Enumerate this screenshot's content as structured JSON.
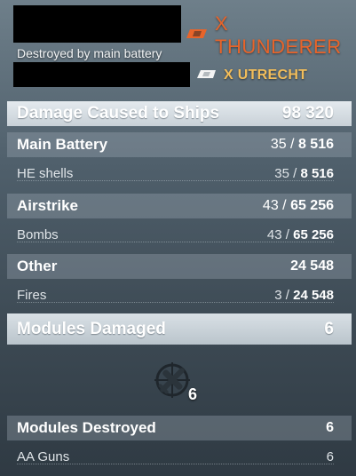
{
  "header": {
    "killed_ship": "X THUNDERER",
    "reason": "Destroyed by main battery",
    "killer_ship": "X UTRECHT"
  },
  "colors": {
    "enemy_accent": "#e8642a",
    "ally_accent": "#f2bd5a"
  },
  "damage": {
    "title": "Damage Caused to Ships",
    "total": "98 320",
    "groups": [
      {
        "label": "Main Battery",
        "hits": "35",
        "damage": "8 516",
        "item": {
          "label": "HE shells",
          "hits": "35",
          "damage": "8 516"
        }
      },
      {
        "label": "Airstrike",
        "hits": "43",
        "damage": "65 256",
        "item": {
          "label": "Bombs",
          "hits": "43",
          "damage": "65 256"
        }
      },
      {
        "label": "Other",
        "hits": "",
        "damage": "24 548",
        "item": {
          "label": "Fires",
          "hits": "3",
          "damage": "24 548"
        }
      }
    ]
  },
  "modules_damaged": {
    "title": "Modules Damaged",
    "count": "6",
    "icon": "aa-guns-module-icon",
    "icon_count": "6"
  },
  "modules_destroyed": {
    "title": "Modules Destroyed",
    "count": "6",
    "item": {
      "label": "AA Guns",
      "count": "6"
    }
  },
  "separator": " / "
}
